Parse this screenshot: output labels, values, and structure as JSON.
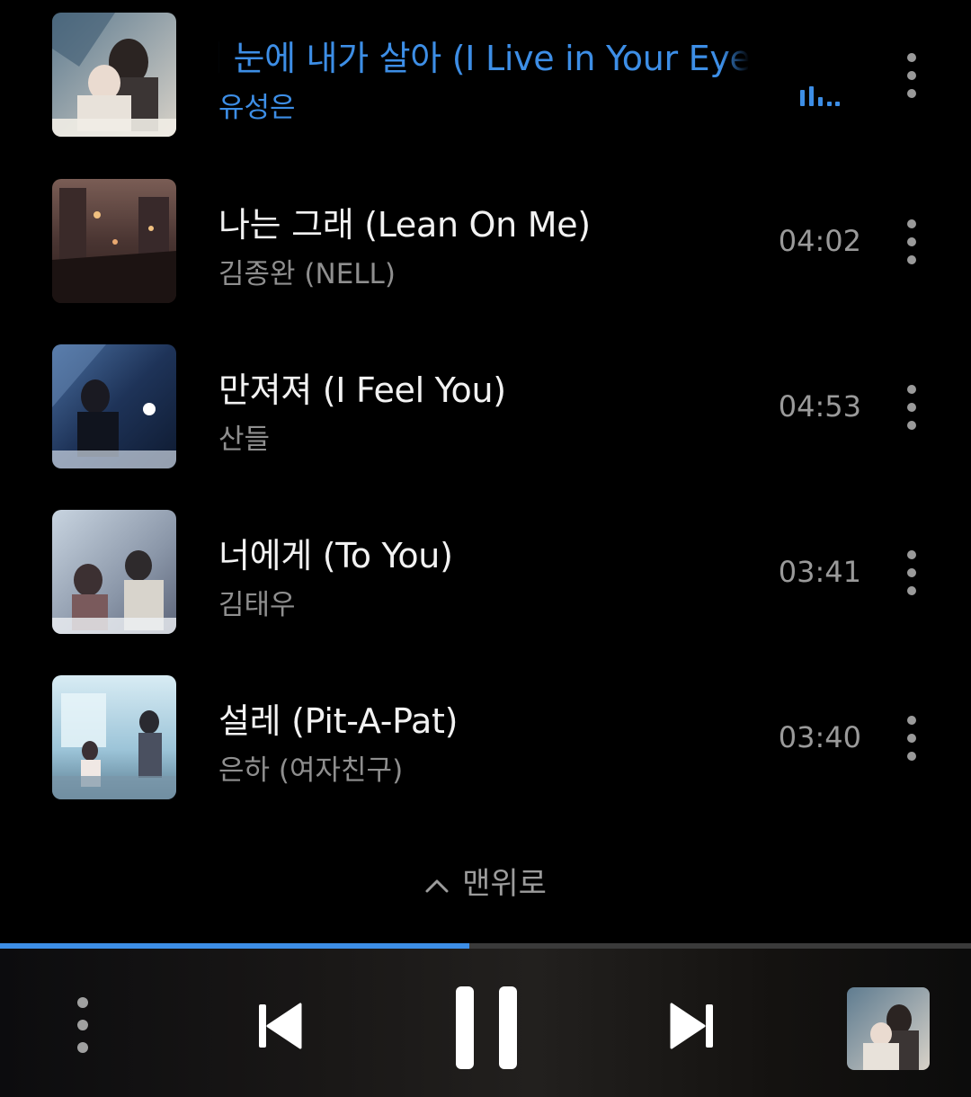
{
  "tracks": [
    {
      "title": "내 눈에 내가 살아 (I Live in Your Eyes)",
      "artist": "유성은",
      "duration": "",
      "playing": true,
      "art_icon": "album-art-couple"
    },
    {
      "title": "나는 그래 (Lean On Me)",
      "artist": "김종완 (NELL)",
      "duration": "04:02",
      "playing": false,
      "art_icon": "album-art-city-night"
    },
    {
      "title": "만져져 (I Feel You)",
      "artist": "산들",
      "duration": "04:53",
      "playing": false,
      "art_icon": "album-art-blue-portrait"
    },
    {
      "title": "너에게 (To You)",
      "artist": "김태우",
      "duration": "03:41",
      "playing": false,
      "art_icon": "album-art-party"
    },
    {
      "title": "설레 (Pit-A-Pat)",
      "artist": "은하 (여자친구)",
      "duration": "03:40",
      "playing": false,
      "art_icon": "album-art-cafe"
    }
  ],
  "scroll_top": {
    "label": "맨위로",
    "icon": "chevron-up-icon"
  },
  "player": {
    "progress": 0.483,
    "icons": [
      "more-vertical-icon",
      "previous-icon",
      "pause-icon",
      "next-icon",
      "now-playing-art"
    ]
  },
  "colors": {
    "accent": "#3d8ee6",
    "background": "#000000",
    "secondary_text": "#8f8f8f"
  }
}
